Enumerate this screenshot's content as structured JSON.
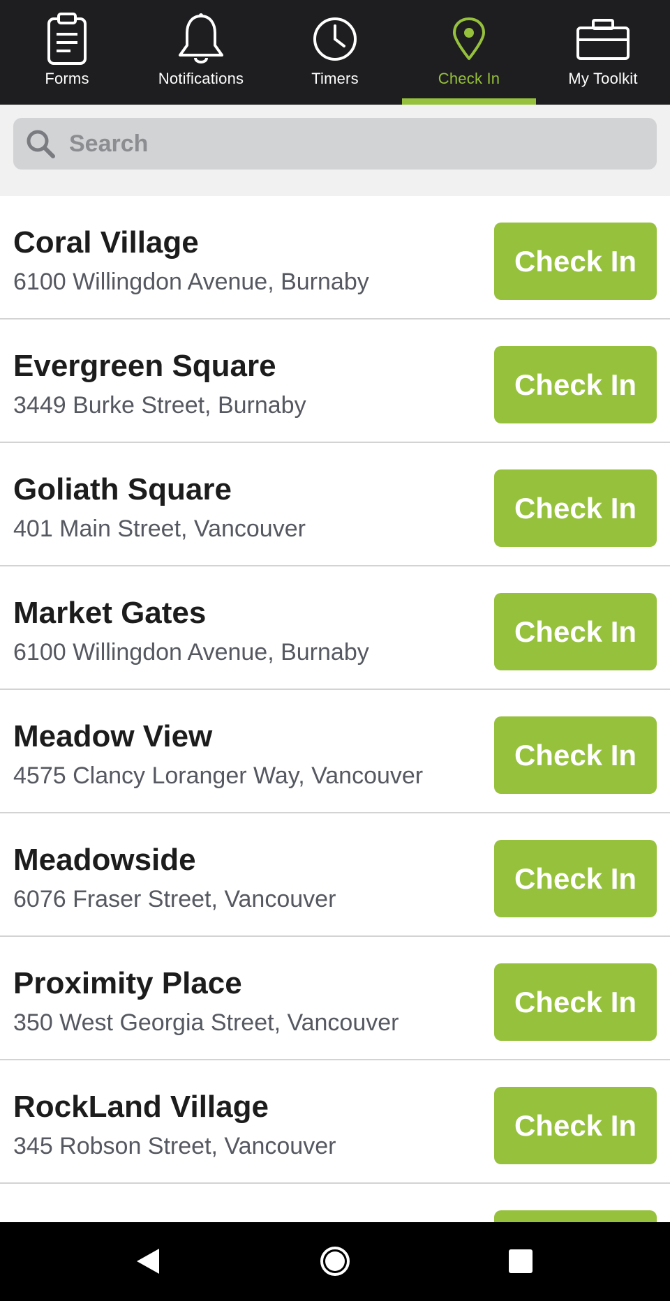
{
  "nav": {
    "tabs": [
      {
        "label": "Forms",
        "icon": "clipboard-icon"
      },
      {
        "label": "Notifications",
        "icon": "bell-icon"
      },
      {
        "label": "Timers",
        "icon": "clock-icon"
      },
      {
        "label": "Check In",
        "icon": "map-pin-icon",
        "active": true
      },
      {
        "label": "My Toolkit",
        "icon": "toolbox-icon"
      }
    ]
  },
  "search": {
    "placeholder": "Search",
    "value": ""
  },
  "locations": [
    {
      "name": "Coral Village",
      "address": "6100 Willingdon Avenue, Burnaby",
      "button": "Check In"
    },
    {
      "name": "Evergreen Square",
      "address": "3449 Burke Street, Burnaby",
      "button": "Check In"
    },
    {
      "name": "Goliath Square",
      "address": "401 Main Street, Vancouver",
      "button": "Check In"
    },
    {
      "name": "Market Gates",
      "address": "6100 Willingdon Avenue, Burnaby",
      "button": "Check In"
    },
    {
      "name": "Meadow View",
      "address": "4575 Clancy Loranger Way, Vancouver",
      "button": "Check In"
    },
    {
      "name": "Meadowside",
      "address": "6076 Fraser Street, Vancouver",
      "button": "Check In"
    },
    {
      "name": "Proximity Place",
      "address": "350 West Georgia Street, Vancouver",
      "button": "Check In"
    },
    {
      "name": "RockLand Village",
      "address": "345 Robson Street, Vancouver",
      "button": "Check In"
    },
    {
      "name": "",
      "address": "",
      "button": ""
    }
  ],
  "colors": {
    "accent": "#96c13c",
    "nav_background": "#1e1e20",
    "search_background": "#d2d3d5",
    "system_bar": "#000000"
  },
  "system_nav": {
    "back": "back-icon",
    "home": "home-icon",
    "recents": "recents-icon"
  }
}
